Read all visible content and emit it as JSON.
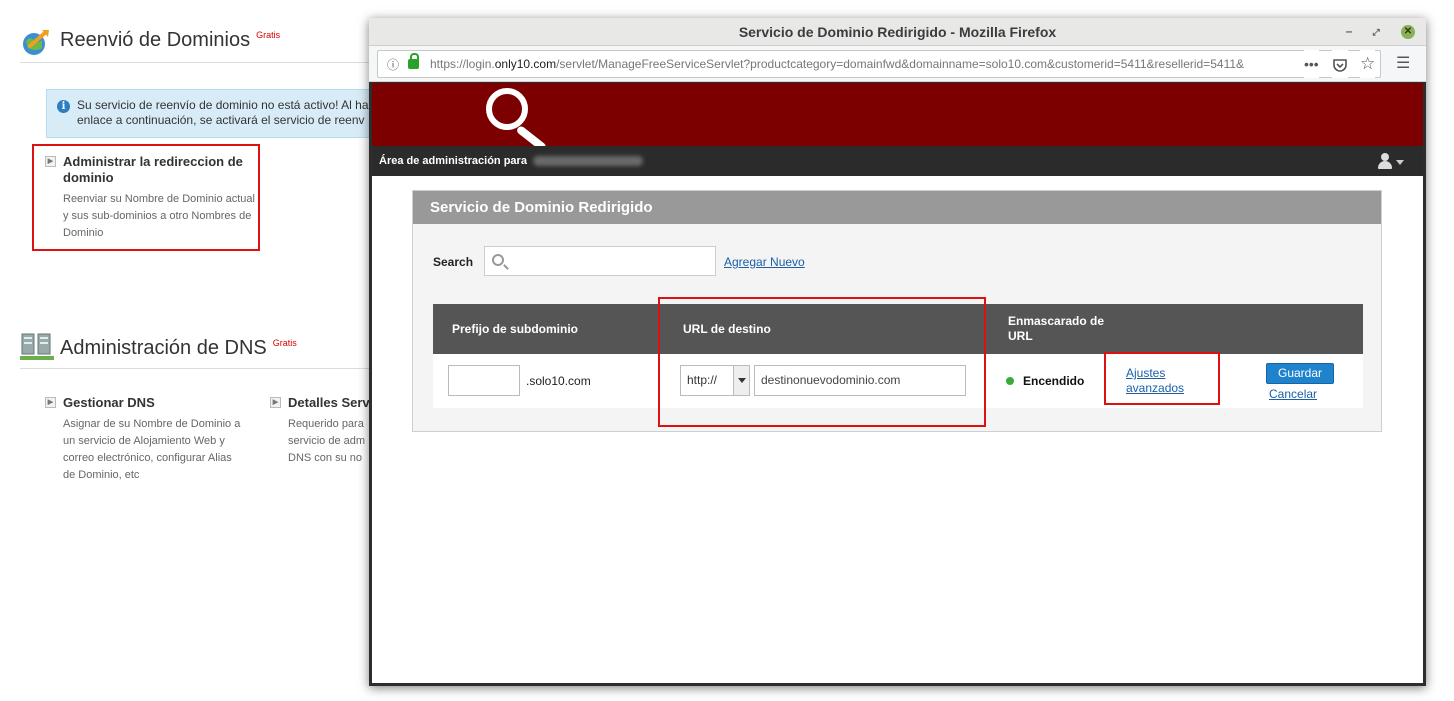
{
  "background": {
    "reenvio": {
      "title": "Reenvió de Dominios",
      "badge": "Gratis",
      "info_line1": "Su servicio de reenvío de dominio no está activo! Al ha",
      "info_line2": "enlace a continuación, se activará el servicio de reenv",
      "feature_title": "Administrar la redireccion de dominio",
      "feature_desc": "Reenviar su Nombre de Dominio actual y sus sub-dominios a otro Nombres de Dominio"
    },
    "dns": {
      "title": "Administración de DNS",
      "badge": "Gratis",
      "gestionar_title": "Gestionar DNS",
      "gestionar_desc": "Asignar de su Nombre de Dominio a un servicio de Alojamiento Web y correo electrónico, configurar Alias de Dominio, etc",
      "detalles_title": "Detalles Serv",
      "detalles_desc": "Requerido para servicio de adm DNS con su no"
    }
  },
  "firefox": {
    "window_title": "Servicio de Dominio Redirigido - Mozilla Firefox",
    "url_prefix": "https://login.",
    "url_host": "only10.com",
    "url_rest": "/servlet/ManageFreeServiceServlet?productcategory=domainfwd&domainname=solo10.com&customerid=5411&resellerid=5411&",
    "icons": {
      "info": "info-icon",
      "lock": "lock-icon",
      "more": "more-icon",
      "pocket": "pocket-icon",
      "star": "star-icon",
      "menu": "hamburger-icon"
    }
  },
  "app": {
    "admin_label": "Área de administración para",
    "panel_title": "Servicio de Dominio Redirigido",
    "search_label": "Search",
    "search_placeholder": "",
    "add_new": "Agregar Nuevo",
    "columns": {
      "prefix": "Prefijo de subdominio",
      "url": "URL de destino",
      "mask": "Enmascarado de URL"
    },
    "row": {
      "prefix_value": "",
      "domain_suffix": ".solo10.com",
      "protocol": "http://",
      "destination": "destinonuevodominio.com",
      "mask_status": "Encendido",
      "advanced": "Ajustes avanzados",
      "save": "Guardar",
      "cancel": "Cancelar"
    }
  },
  "colors": {
    "banner": "#7d0000",
    "accent_button": "#1e82cc",
    "highlight_red": "#dd1111",
    "status_on": "#3aab3a"
  }
}
